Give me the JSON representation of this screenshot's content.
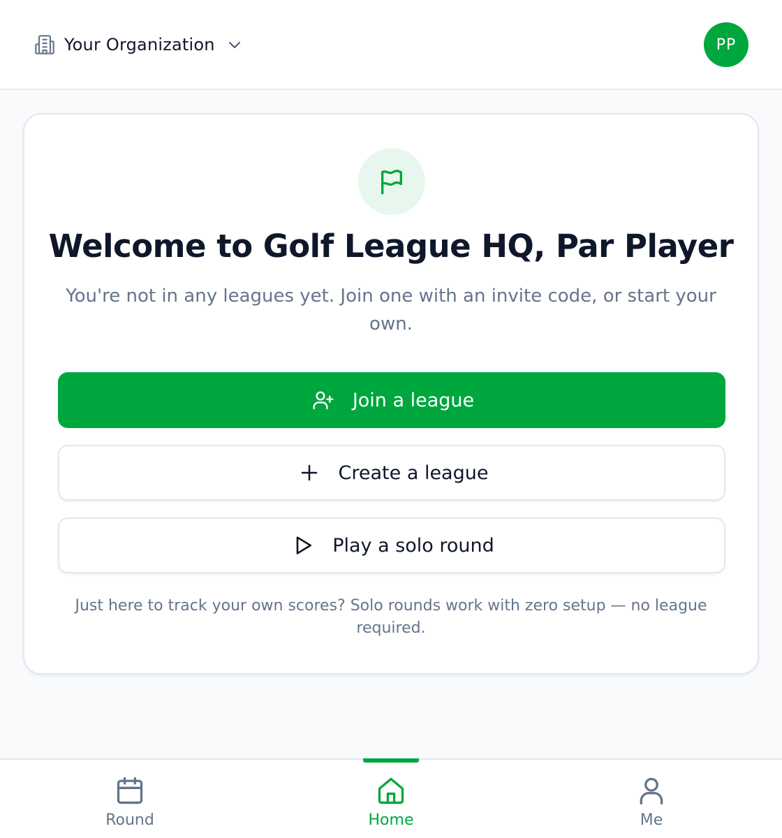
{
  "header": {
    "org_name": "Your Organization",
    "org_icon": "building-icon",
    "avatar_initials": "PP"
  },
  "welcome_card": {
    "icon": "flag-icon",
    "title": "Welcome to Golf League HQ, Par Player",
    "subtitle": "You're not in any leagues yet. Join one with an invite code, or start your own.",
    "buttons": {
      "join_label": "Join a league",
      "create_label": "Create a league",
      "solo_label": "Play a solo round"
    },
    "footnote": "Just here to track your own scores? Solo rounds work with zero setup — no league required."
  },
  "bottom_nav": {
    "items": [
      {
        "label": "Round",
        "icon": "calendar-icon"
      },
      {
        "label": "Home",
        "icon": "home-icon"
      },
      {
        "label": "Me",
        "icon": "user-icon"
      }
    ],
    "active": "Home"
  },
  "colors": {
    "brand": "#00a63e",
    "text_primary": "#0f172a",
    "text_muted": "#64748b",
    "border": "#e2e8f0",
    "background": "#f8fafc",
    "icon_bg": "#e8f7ee"
  }
}
